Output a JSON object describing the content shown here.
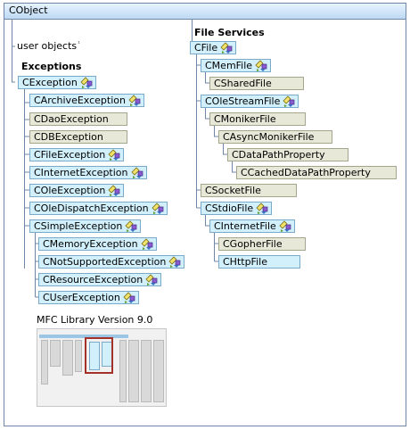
{
  "diagram": {
    "root": "CObject",
    "user_objects_label": "user objects",
    "user_objects_note": "¹",
    "exceptions_heading": "Exceptions",
    "file_services_heading": "File Services",
    "nodes": {
      "cexception": "CException",
      "carchiveexception": "CArchiveException",
      "cdaoexception": "CDaoException",
      "cdbexception": "CDBException",
      "cfileexception": "CFileException",
      "cinternetexception": "CInternetException",
      "coleexception": "COleException",
      "coledispatchexception": "COleDispatchException",
      "csimpleexception": "CSimpleException",
      "cmemoryexception": "CMemoryException",
      "cnotsupportedexception": "CNotSupportedException",
      "cresourceexception": "CResourceException",
      "cuserexception": "CUserException",
      "cfile": "CFile",
      "cmemfile": "CMemFile",
      "csharedfile": "CSharedFile",
      "colestreamfile": "COleStreamFile",
      "cmonikerfile": "CMonikerFile",
      "casyncmonikerfile": "CAsyncMonikerFile",
      "cdatapathproperty": "CDataPathProperty",
      "ccacheddatapathproperty": "CCachedDataPathProperty",
      "csocketfile": "CSocketFile",
      "cstdiofile": "CStdioFile",
      "cinternetfile": "CInternetFile",
      "cgopherfile": "CGopherFile",
      "chttpfile": "CHttpFile"
    },
    "minimap_caption": "MFC Library Version 9.0"
  },
  "colors": {
    "blue_node": "#d2f0fb",
    "gray_node": "#e7e8d8",
    "connector": "#6f86a6",
    "highlight": "#a3312a"
  }
}
